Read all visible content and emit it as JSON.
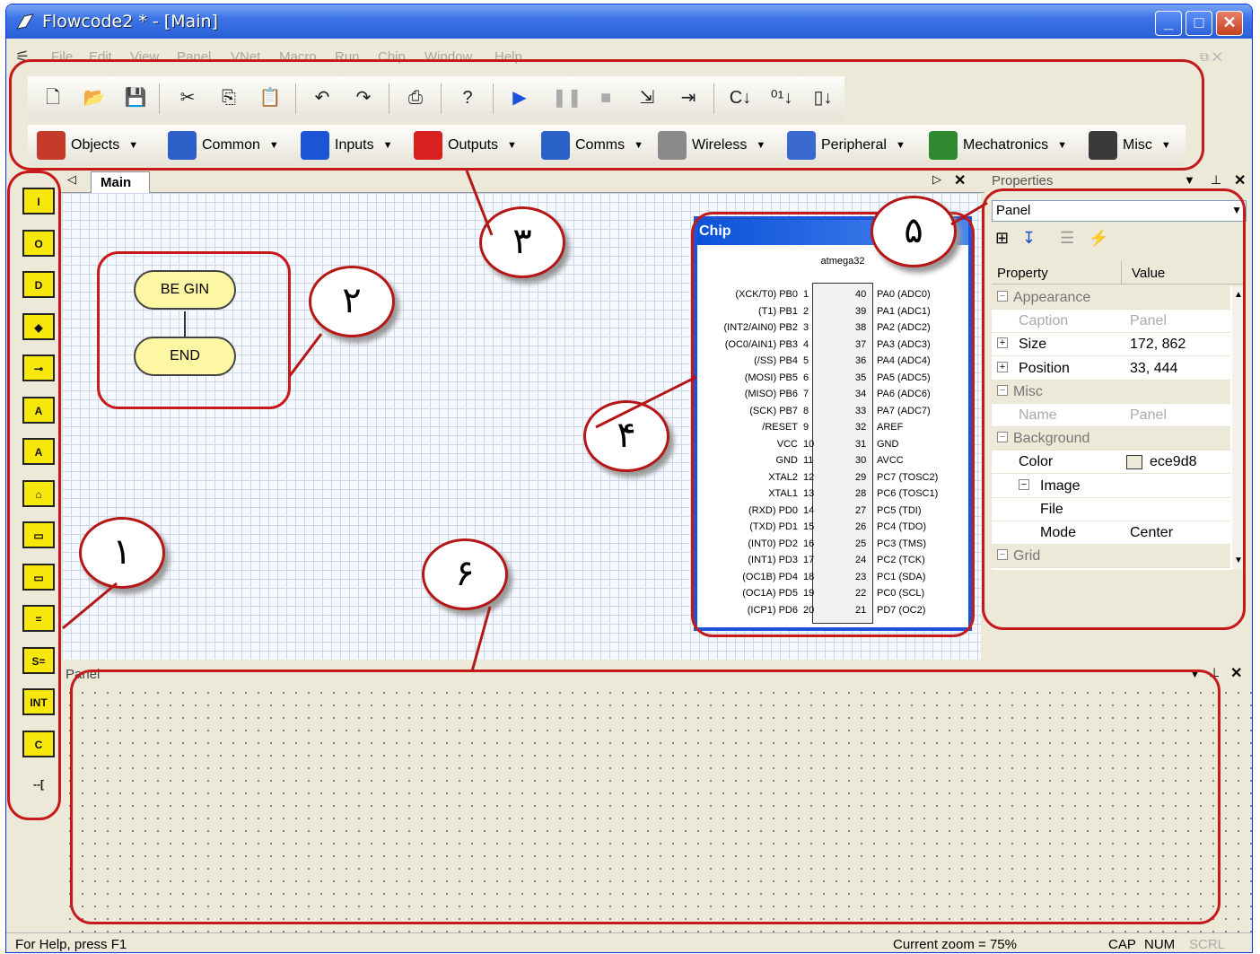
{
  "window": {
    "title": "Flowcode2 * - [Main]",
    "min": "_",
    "max": "□",
    "close": "✕"
  },
  "menu": [
    "File",
    "Edit",
    "View",
    "Panel",
    "VNet",
    "Macro",
    "Run",
    "Chip",
    "Window",
    "Help"
  ],
  "toolbar1": [
    "new-icon",
    "open-icon",
    "save-icon",
    "cut-icon",
    "copy-icon",
    "paste-icon",
    "undo-icon",
    "redo-icon",
    "print-icon",
    "help-icon",
    "run-icon",
    "pause-icon",
    "stop-icon",
    "step-into-icon",
    "step-over-icon",
    "compile-c-icon",
    "compile-hex-icon",
    "chip-program-icon"
  ],
  "components": [
    {
      "label": "Objects",
      "color": "#c53b2a"
    },
    {
      "label": "Common",
      "color": "#2e5fc9"
    },
    {
      "label": "Inputs",
      "color": "#1a55d6"
    },
    {
      "label": "Outputs",
      "color": "#d82020"
    },
    {
      "label": "Comms",
      "color": "#2b62c7"
    },
    {
      "label": "Wireless",
      "color": "#8a8a8a"
    },
    {
      "label": "Peripheral",
      "color": "#3a6ad0"
    },
    {
      "label": "Mechatronics",
      "color": "#2f8a2f"
    },
    {
      "label": "Misc",
      "color": "#3a3a3a"
    }
  ],
  "flow_icons": [
    "I",
    "O",
    "D",
    "◆",
    "⊸",
    "A",
    "A",
    "⌂",
    "▭",
    "▭",
    "=",
    "S=",
    "INT",
    "C",
    "--["
  ],
  "tab": {
    "label": "Main"
  },
  "flowchart": {
    "begin": "BE GIN",
    "end": "END"
  },
  "chip": {
    "window_title": "Chip",
    "part": "atmega32",
    "left_pins": [
      "(XCK/T0) PB0",
      "(T1) PB1",
      "(INT2/AIN0) PB2",
      "(OC0/AIN1) PB3",
      "(/SS) PB4",
      "(MOSI) PB5",
      "(MISO) PB6",
      "(SCK) PB7",
      "/RESET",
      "VCC",
      "GND",
      "XTAL2",
      "XTAL1",
      "(RXD) PD0",
      "(TXD) PD1",
      "(INT0) PD2",
      "(INT1) PD3",
      "(OC1B) PD4",
      "(OC1A) PD5",
      "(ICP1) PD6"
    ],
    "left_nums": [
      "1",
      "2",
      "3",
      "4",
      "5",
      "6",
      "7",
      "8",
      "9",
      "10",
      "11",
      "12",
      "13",
      "14",
      "15",
      "16",
      "17",
      "18",
      "19",
      "20"
    ],
    "right_pins": [
      "PA0 (ADC0)",
      "PA1 (ADC1)",
      "PA2 (ADC2)",
      "PA3 (ADC3)",
      "PA4 (ADC4)",
      "PA5 (ADC5)",
      "PA6 (ADC6)",
      "PA7 (ADC7)",
      "AREF",
      "GND",
      "AVCC",
      "PC7 (TOSC2)",
      "PC6 (TOSC1)",
      "PC5 (TDI)",
      "PC4 (TDO)",
      "PC3 (TMS)",
      "PC2 (TCK)",
      "PC1 (SDA)",
      "PC0 (SCL)",
      "PD7 (OC2)"
    ],
    "right_nums": [
      "40",
      "39",
      "38",
      "37",
      "36",
      "35",
      "34",
      "33",
      "32",
      "31",
      "30",
      "29",
      "28",
      "27",
      "26",
      "25",
      "24",
      "23",
      "22",
      "21"
    ]
  },
  "properties": {
    "title": "Properties",
    "selected": "Panel",
    "col_property": "Property",
    "col_value": "Value",
    "rows": [
      {
        "key": "Appearance",
        "value": "",
        "cat": true
      },
      {
        "key": "Caption",
        "value": "Panel",
        "grey": true
      },
      {
        "key": "Size",
        "value": "172, 862",
        "plus": true
      },
      {
        "key": "Position",
        "value": "33, 444",
        "plus": true
      },
      {
        "key": "Misc",
        "value": "",
        "cat": true
      },
      {
        "key": "Name",
        "value": "Panel",
        "grey": true
      },
      {
        "key": "Background",
        "value": "",
        "cat": true
      },
      {
        "key": "Color",
        "value": "ece9d8",
        "swatch": true
      },
      {
        "key": "Image",
        "value": "",
        "sub": true
      },
      {
        "key": "File",
        "value": ""
      },
      {
        "key": "Mode",
        "value": "Center"
      },
      {
        "key": "Grid",
        "value": "",
        "cat": true
      }
    ],
    "bg_color": "#ece9d8"
  },
  "panel": {
    "title": "Panel"
  },
  "status": {
    "help": "For Help, press F1",
    "zoom": "Current zoom = 75%",
    "cap": "CAP",
    "num": "NUM",
    "scrl": "SCRL"
  },
  "annotations": [
    "١",
    "٢",
    "٣",
    "۴",
    "۵",
    "۶"
  ]
}
